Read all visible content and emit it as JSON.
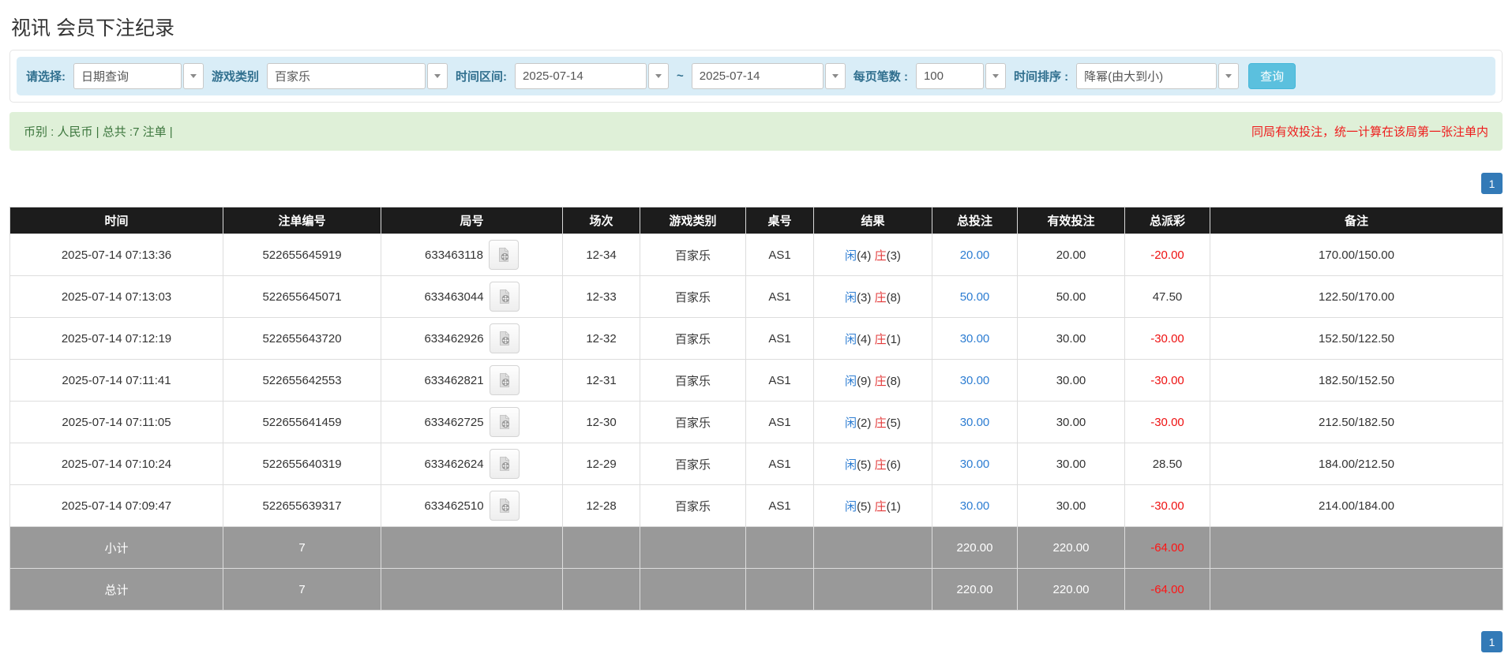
{
  "page": {
    "title": "视讯 会员下注纪录"
  },
  "filter_bar": {
    "select_label": "请选择:",
    "select_value": "日期查询",
    "game_type_label": "游戏类别",
    "game_type_value": "百家乐",
    "date_range_label": "时间区间:",
    "date_from": "2025-07-14",
    "date_separator": "~",
    "date_to": "2025-07-14",
    "page_size_label": "每页笔数 :",
    "page_size_value": "100",
    "sort_label": "时间排序 :",
    "sort_value": "降幂(由大到小)",
    "query_button_label": "查询"
  },
  "summary_bar": {
    "currency_summary": "币别 : 人民币 | 总共 :7 注单 |",
    "note": "同局有效投注，统一计算在该局第一张注单内"
  },
  "pagination": {
    "page_label": "1"
  },
  "table": {
    "headers": [
      "时间",
      "注单编号",
      "局号",
      "场次",
      "游戏类别",
      "桌号",
      "结果",
      "总投注",
      "有效投注",
      "总派彩",
      "备注"
    ],
    "rows": [
      {
        "time": "2025-07-14 07:13:36",
        "bet_no": "522655645919",
        "round_no": "633463118",
        "session": "12-34",
        "game": "百家乐",
        "table_no": "AS1",
        "result": {
          "player_label": "闲",
          "player_value": "(4)",
          "banker_label": "庄",
          "banker_value": "(3)"
        },
        "total_bet": "20.00",
        "valid_bet": "20.00",
        "payout": "-20.00",
        "note": "170.00/150.00"
      },
      {
        "time": "2025-07-14 07:13:03",
        "bet_no": "522655645071",
        "round_no": "633463044",
        "session": "12-33",
        "game": "百家乐",
        "table_no": "AS1",
        "result": {
          "player_label": "闲",
          "player_value": "(3)",
          "banker_label": "庄",
          "banker_value": "(8)"
        },
        "total_bet": "50.00",
        "valid_bet": "50.00",
        "payout": "47.50",
        "note": "122.50/170.00"
      },
      {
        "time": "2025-07-14 07:12:19",
        "bet_no": "522655643720",
        "round_no": "633462926",
        "session": "12-32",
        "game": "百家乐",
        "table_no": "AS1",
        "result": {
          "player_label": "闲",
          "player_value": "(4)",
          "banker_label": "庄",
          "banker_value": "(1)"
        },
        "total_bet": "30.00",
        "valid_bet": "30.00",
        "payout": "-30.00",
        "note": "152.50/122.50"
      },
      {
        "time": "2025-07-14 07:11:41",
        "bet_no": "522655642553",
        "round_no": "633462821",
        "session": "12-31",
        "game": "百家乐",
        "table_no": "AS1",
        "result": {
          "player_label": "闲",
          "player_value": "(9)",
          "banker_label": "庄",
          "banker_value": "(8)"
        },
        "total_bet": "30.00",
        "valid_bet": "30.00",
        "payout": "-30.00",
        "note": "182.50/152.50"
      },
      {
        "time": "2025-07-14 07:11:05",
        "bet_no": "522655641459",
        "round_no": "633462725",
        "session": "12-30",
        "game": "百家乐",
        "table_no": "AS1",
        "result": {
          "player_label": "闲",
          "player_value": "(2)",
          "banker_label": "庄",
          "banker_value": "(5)"
        },
        "total_bet": "30.00",
        "valid_bet": "30.00",
        "payout": "-30.00",
        "note": "212.50/182.50"
      },
      {
        "time": "2025-07-14 07:10:24",
        "bet_no": "522655640319",
        "round_no": "633462624",
        "session": "12-29",
        "game": "百家乐",
        "table_no": "AS1",
        "result": {
          "player_label": "闲",
          "player_value": "(5)",
          "banker_label": "庄",
          "banker_value": "(6)"
        },
        "total_bet": "30.00",
        "valid_bet": "30.00",
        "payout": "28.50",
        "note": "184.00/212.50"
      },
      {
        "time": "2025-07-14 07:09:47",
        "bet_no": "522655639317",
        "round_no": "633462510",
        "session": "12-28",
        "game": "百家乐",
        "table_no": "AS1",
        "result": {
          "player_label": "闲",
          "player_value": "(5)",
          "banker_label": "庄",
          "banker_value": "(1)"
        },
        "total_bet": "30.00",
        "valid_bet": "30.00",
        "payout": "-30.00",
        "note": "214.00/184.00"
      }
    ],
    "totals": [
      {
        "label": "小计",
        "count": "7",
        "total_bet": "220.00",
        "valid_bet": "220.00",
        "payout": "-64.00"
      },
      {
        "label": "总计",
        "count": "7",
        "total_bet": "220.00",
        "valid_bet": "220.00",
        "payout": "-64.00"
      }
    ]
  },
  "colors": {
    "accent_blue": "#2d7dd2",
    "player_blue": "#2d7dd2",
    "banker_red": "#e33b3b",
    "negative_red": "#ee1111",
    "query_button_blue": "#5bc0de",
    "pager_blue": "#337ab7",
    "filter_bar_bg": "#d9edf7",
    "filter_label_color": "#31708f",
    "summary_bg": "#dff0d8",
    "summary_text": "#3c763d",
    "note_red": "#ee1c1c",
    "table_header_bg": "#1c1c1c",
    "total_row_gray": "#999999"
  }
}
